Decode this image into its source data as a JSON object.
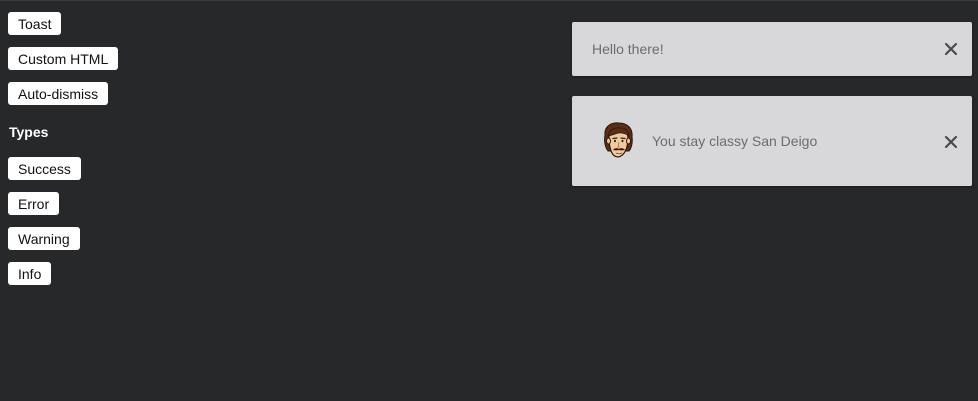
{
  "buttons": {
    "toast": "Toast",
    "custom_html": "Custom HTML",
    "auto_dismiss": "Auto-dismiss"
  },
  "types": {
    "heading": "Types",
    "success": "Success",
    "error": "Error",
    "warning": "Warning",
    "info": "Info"
  },
  "toasts": [
    {
      "message": "Hello there!",
      "close_icon": "close-icon"
    },
    {
      "message": "You stay classy San Deigo",
      "avatar_icon": "mustache-man-avatar-icon",
      "close_icon": "close-icon"
    }
  ],
  "colors": {
    "background": "#27282a",
    "toast_background": "#d8d8da",
    "toast_text": "#6c6c6c",
    "button_background": "#ffffff"
  }
}
